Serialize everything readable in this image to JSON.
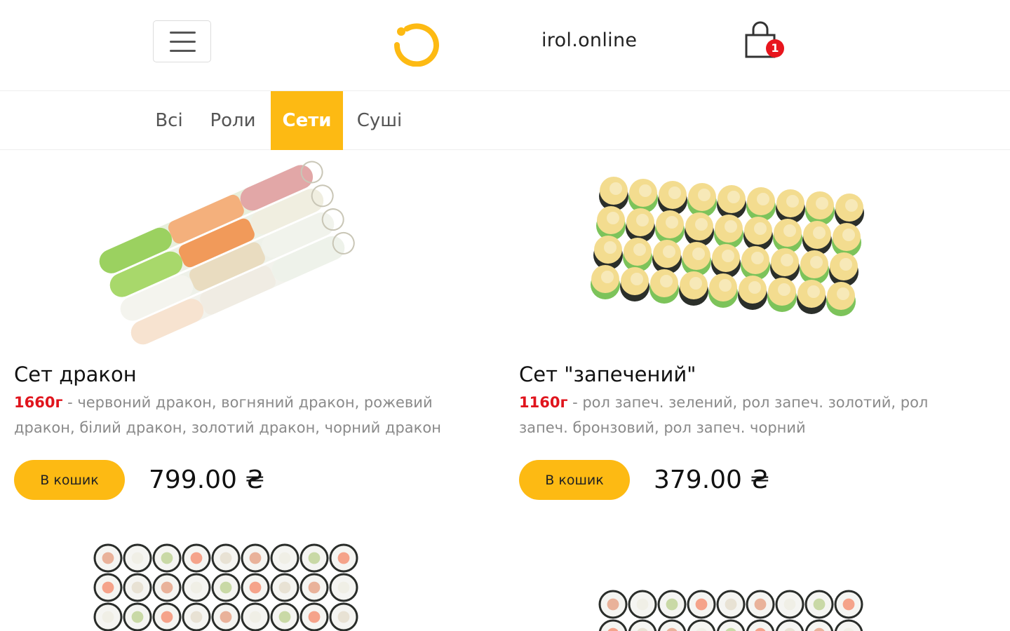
{
  "header": {
    "site_name": "irol.online",
    "cart_count": "1",
    "brand_color": "#fdba13",
    "badge_color": "#e8151d",
    "icons": [
      "menu-icon",
      "logo-ring-icon",
      "shopping-bag-icon"
    ]
  },
  "tabs": [
    {
      "label": "Всі",
      "active": false
    },
    {
      "label": "Роли",
      "active": false
    },
    {
      "label": "Сети",
      "active": true
    },
    {
      "label": "Суші",
      "active": false
    }
  ],
  "products": [
    {
      "title": "Сет дракон",
      "weight": "1660г",
      "description": " - червоний дракон, вогняний дракон, рожевий дракон, білий дракон, золотий дракон, чорний дракон",
      "button_label": "В кошик",
      "price": "799.00 ₴"
    },
    {
      "title": "Сет \"запечений\"",
      "weight": "1160г",
      "description": " - рол запеч. зелений, рол запеч. золотий, рол запеч. бронзовий, рол запеч. чорний",
      "button_label": "В кошик",
      "price": "379.00 ₴"
    }
  ]
}
